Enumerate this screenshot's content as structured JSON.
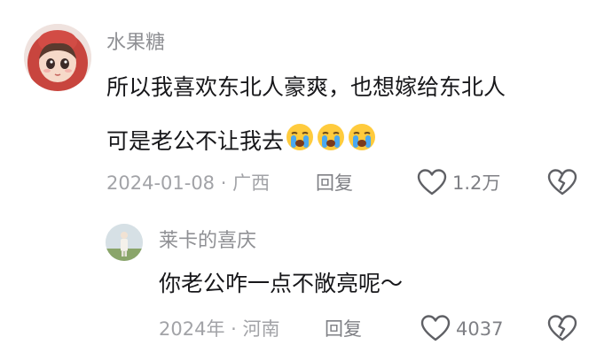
{
  "comments": [
    {
      "username": "水果糖",
      "line1": "所以我喜欢东北人豪爽，也想嫁给东北人",
      "line2": "可是老公不让我去",
      "emoji_count": 3,
      "meta": "2024-01-08 · 广西",
      "reply_label": "回复",
      "likes": "1.2万",
      "avatar_icon": "cartoon-girl-red-hood-avatar",
      "like_icon": "heart-outline-icon",
      "dislike_icon": "broken-heart-icon"
    },
    {
      "username": "莱卡的喜庆",
      "text": "你老公咋一点不敞亮呢～",
      "meta": "2024年 · 河南",
      "reply_label": "回复",
      "likes": "4037",
      "avatar_icon": "person-standing-photo-avatar",
      "like_icon": "heart-outline-icon",
      "dislike_icon": "broken-heart-icon"
    }
  ],
  "colors": {
    "username": "#8f9094",
    "content": "#17171a",
    "meta": "#a2a3a7",
    "icon": "#5f6065"
  }
}
